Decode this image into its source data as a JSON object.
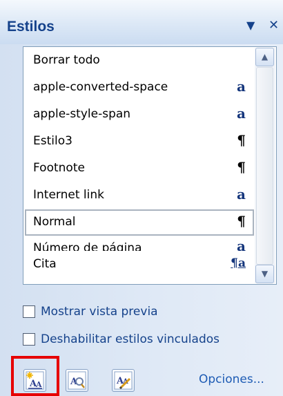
{
  "pane": {
    "title": "Estilos",
    "dropdown_icon": "chevron-down-icon",
    "close_icon": "close-icon"
  },
  "styles": [
    {
      "label": "Borrar todo",
      "indicator": ""
    },
    {
      "label": "apple-converted-space",
      "indicator": "a"
    },
    {
      "label": "apple-style-span",
      "indicator": "a"
    },
    {
      "label": "Estilo3",
      "indicator": "¶"
    },
    {
      "label": "Footnote",
      "indicator": "¶"
    },
    {
      "label": "Internet link",
      "indicator": "a"
    },
    {
      "label": "Normal",
      "indicator": "¶",
      "selected": true
    },
    {
      "label": "Número de página",
      "indicator": "a"
    },
    {
      "label": "Cita",
      "indicator": "¶a"
    }
  ],
  "options": {
    "show_preview": {
      "label": "Mostrar vista previa",
      "checked": false
    },
    "disable_linked": {
      "label": "Deshabilitar estilos vinculados",
      "checked": false
    }
  },
  "toolbar": {
    "new_style_icon": "new-style-icon",
    "style_inspector_icon": "style-inspector-icon",
    "manage_styles_icon": "manage-styles-icon",
    "options_link": "Opciones..."
  },
  "colors": {
    "title": "#15428b",
    "highlight": "#e60000",
    "link": "#1d5bb4"
  }
}
